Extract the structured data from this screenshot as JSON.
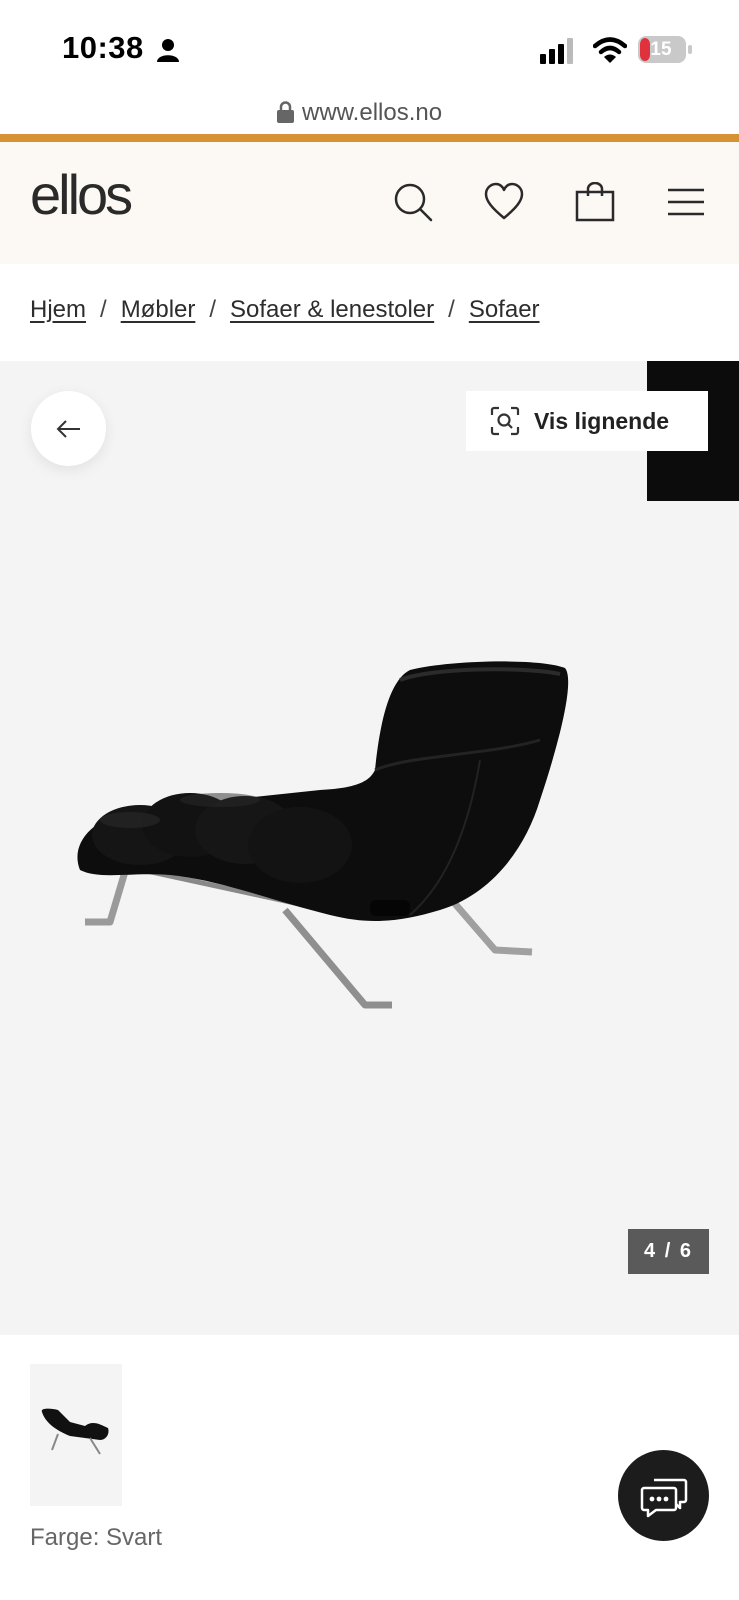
{
  "status_bar": {
    "time": "10:38",
    "battery": "15",
    "icons": [
      "person-icon",
      "signal-icon",
      "wifi-icon",
      "battery-icon"
    ]
  },
  "url_bar": {
    "url": "www.ellos.no",
    "icon": "lock-icon"
  },
  "header": {
    "logo": "ellos",
    "accent_color": "#d89236",
    "background_color": "#fcf8f4",
    "icons": [
      "search-icon",
      "heart-icon",
      "bag-icon",
      "menu-icon"
    ]
  },
  "breadcrumb": {
    "items": [
      {
        "label": "Hjem"
      },
      {
        "label": "Møbler"
      },
      {
        "label": "Sofaer & lenestoler"
      },
      {
        "label": "Sofaer"
      }
    ],
    "separator": "/"
  },
  "gallery": {
    "vis_lignende_label": "Vis lignende",
    "counter": "4 / 6",
    "background_color": "#f4f4f4"
  },
  "product": {
    "color_label": "Farge: Svart"
  }
}
